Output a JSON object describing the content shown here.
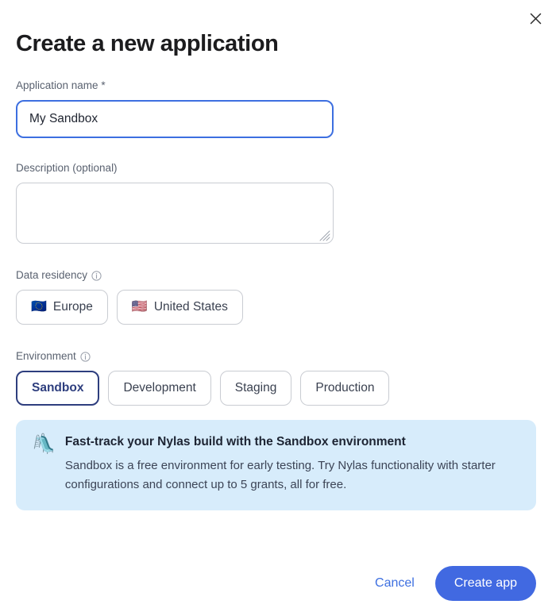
{
  "dialog": {
    "title": "Create a new application",
    "close_label": "close-icon"
  },
  "fields": {
    "app_name": {
      "label": "Application name *",
      "value": "My Sandbox",
      "placeholder": ""
    },
    "description": {
      "label": "Description (optional)",
      "value": "",
      "placeholder": ""
    },
    "data_residency": {
      "label": "Data residency",
      "options": [
        {
          "label": "Europe",
          "flag": "🇪🇺",
          "selected": false
        },
        {
          "label": "United States",
          "flag": "🇺🇸",
          "selected": false
        }
      ]
    },
    "environment": {
      "label": "Environment",
      "options": [
        {
          "label": "Sandbox",
          "selected": true
        },
        {
          "label": "Development",
          "selected": false
        },
        {
          "label": "Staging",
          "selected": false
        },
        {
          "label": "Production",
          "selected": false
        }
      ]
    }
  },
  "banner": {
    "icon": "🛝",
    "title": "Fast-track your Nylas build with the Sandbox environment",
    "body": "Sandbox is a free environment for early testing. Try Nylas functionality with starter configurations and connect up to 5 grants, all for free."
  },
  "footer": {
    "cancel_label": "Cancel",
    "create_label": "Create app"
  },
  "colors": {
    "accent_blue": "#4169e1",
    "focus_blue": "#3d6fe0",
    "selected_navy": "#2e3e7e",
    "banner_bg": "#d7ecfb",
    "border_gray": "#c9ccd2"
  }
}
